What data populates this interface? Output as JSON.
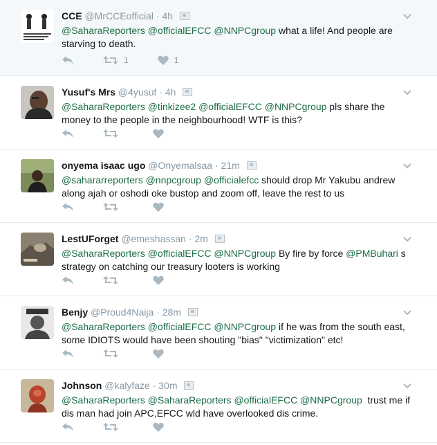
{
  "colors": {
    "mention": "#1b6c45",
    "meta": "#8899a6",
    "icon": "#aab8c2",
    "highlight_bg": "#f5f8fa"
  },
  "icons": {
    "reply": "reply-icon",
    "retweet": "retweet-icon",
    "like": "heart-icon",
    "more": "chevron-down-icon",
    "badge": "flag-icon"
  },
  "tweets": [
    {
      "name": "CCE",
      "handle": "@MrCCEofficial",
      "time": "4h",
      "parts": [
        "@SaharaReporters",
        " ",
        "@officialEFCC",
        " ",
        "@NNPCgroup",
        " what a life! And people are starving to death."
      ],
      "retweets": "1",
      "likes": "1"
    },
    {
      "name": "Yusuf's Mrs",
      "handle": "@4yusuf",
      "time": "4h",
      "parts": [
        "@SaharaReporters",
        " ",
        "@tinkizee2",
        " ",
        "@officialEFCC",
        " ",
        "@NNPCgroup",
        " pls share the money to the people in the neighbourhood! WTF is this?"
      ],
      "retweets": "",
      "likes": ""
    },
    {
      "name": "onyema isaac ugo",
      "handle": "@Onyemalsaa",
      "time": "21m",
      "parts": [
        "@sahararreporters",
        " ",
        "@nnpcgroup",
        " ",
        "@officialefcc",
        " should drop Mr Yakubu andrew along ajah or oshodi oke bustop and zoom off, leave the rest to us"
      ],
      "retweets": "",
      "likes": ""
    },
    {
      "name": "LestUForget",
      "handle": "@emeshassan",
      "time": "2m",
      "parts": [
        "@SaharaReporters",
        " ",
        "@officialEFCC",
        " ",
        "@NNPCgroup",
        " By fire by force ",
        "@PMBuhari",
        " s strategy on catching our treasury looters is working"
      ],
      "retweets": "",
      "likes": ""
    },
    {
      "name": "Benjy",
      "handle": "@Proud4Naija",
      "time": "28m",
      "parts": [
        "@SaharaReporters",
        " ",
        "@officialEFCC",
        " ",
        "@NNPCgroup",
        " if he was from the south east, some IDIOTS would have been shouting \"bias\" \"victimization\" etc!"
      ],
      "retweets": "",
      "likes": ""
    },
    {
      "name": "Johnson",
      "handle": "@kalyfaze",
      "time": "30m",
      "parts": [
        "@SaharaReporters",
        " ",
        "@SaharaReporters",
        " ",
        "@officialEFCC",
        " ",
        "@NNPCgroup",
        "  trust me if dis man had join APC,EFCC wld have overlooked dis crime."
      ],
      "retweets": "",
      "likes": ""
    }
  ]
}
